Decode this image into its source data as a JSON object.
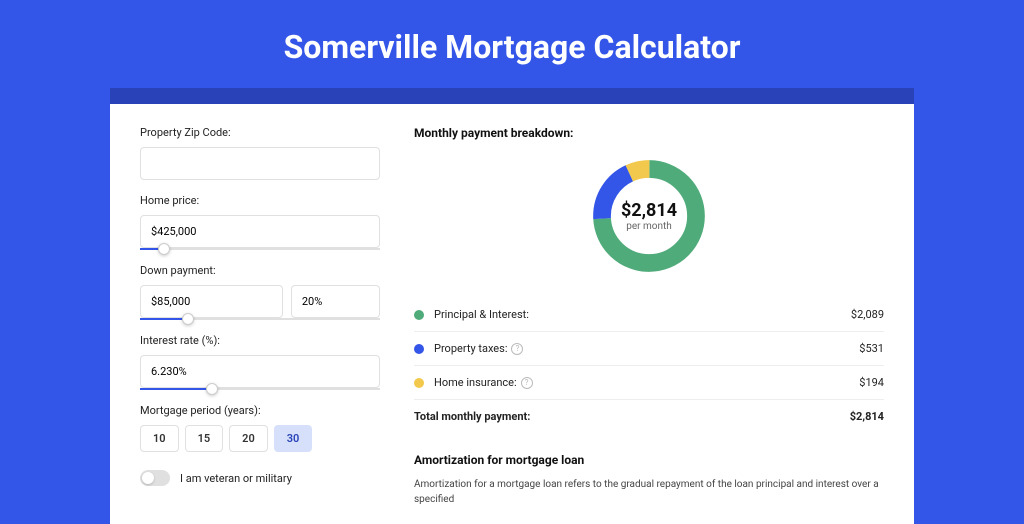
{
  "title": "Somerville Mortgage Calculator",
  "form": {
    "zip_label": "Property Zip Code:",
    "zip_value": "",
    "price_label": "Home price:",
    "price_value": "$425,000",
    "price_slider_pct": 10,
    "down_label": "Down payment:",
    "down_value": "$85,000",
    "down_pct": "20%",
    "down_slider_pct": 20,
    "rate_label": "Interest rate (%):",
    "rate_value": "6.230%",
    "rate_slider_pct": 30,
    "period_label": "Mortgage period (years):",
    "periods": [
      "10",
      "15",
      "20",
      "30"
    ],
    "period_active": 3,
    "veteran_label": "I am veteran or military"
  },
  "breakdown": {
    "title": "Monthly payment breakdown:",
    "center_amount": "$2,814",
    "center_sub": "per month",
    "items": [
      {
        "label": "Principal & Interest:",
        "value": "$2,089",
        "color": "#4fab7a",
        "pct": 74
      },
      {
        "label": "Property taxes:",
        "value": "$531",
        "color": "#3355e8",
        "pct": 19,
        "info": true
      },
      {
        "label": "Home insurance:",
        "value": "$194",
        "color": "#f2c94c",
        "pct": 7,
        "info": true
      }
    ],
    "total_label": "Total monthly payment:",
    "total_value": "$2,814"
  },
  "amort": {
    "title": "Amortization for mortgage loan",
    "text": "Amortization for a mortgage loan refers to the gradual repayment of the loan principal and interest over a specified"
  },
  "chart_data": {
    "type": "pie",
    "title": "Monthly payment breakdown",
    "series": [
      {
        "name": "Principal & Interest",
        "value": 2089,
        "color": "#4fab7a"
      },
      {
        "name": "Property taxes",
        "value": 531,
        "color": "#3355e8"
      },
      {
        "name": "Home insurance",
        "value": 194,
        "color": "#f2c94c"
      }
    ],
    "total": 2814,
    "center_label": "$2,814 per month"
  }
}
